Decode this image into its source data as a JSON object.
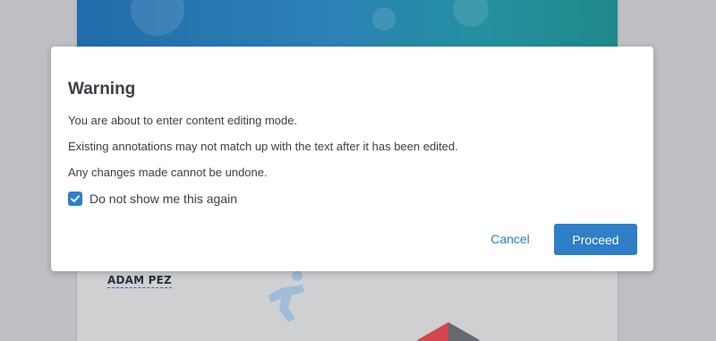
{
  "background_document": {
    "author_label": "ADAM PEZ"
  },
  "dialog": {
    "title": "Warning",
    "message_lines": [
      "You are about to enter content editing mode.",
      "Existing annotations may not match up with the text after it has been edited.",
      "Any changes made cannot be undone."
    ],
    "checkbox": {
      "label": "Do not show me this again",
      "checked": true
    },
    "cancel_label": "Cancel",
    "proceed_label": "Proceed"
  },
  "colors": {
    "accent": "#2f7ec8",
    "text": "#3d4046",
    "banner_start": "#1f6fb3",
    "banner_end": "#1e8e90"
  },
  "icons": {
    "checkbox": "checkmark-icon"
  }
}
